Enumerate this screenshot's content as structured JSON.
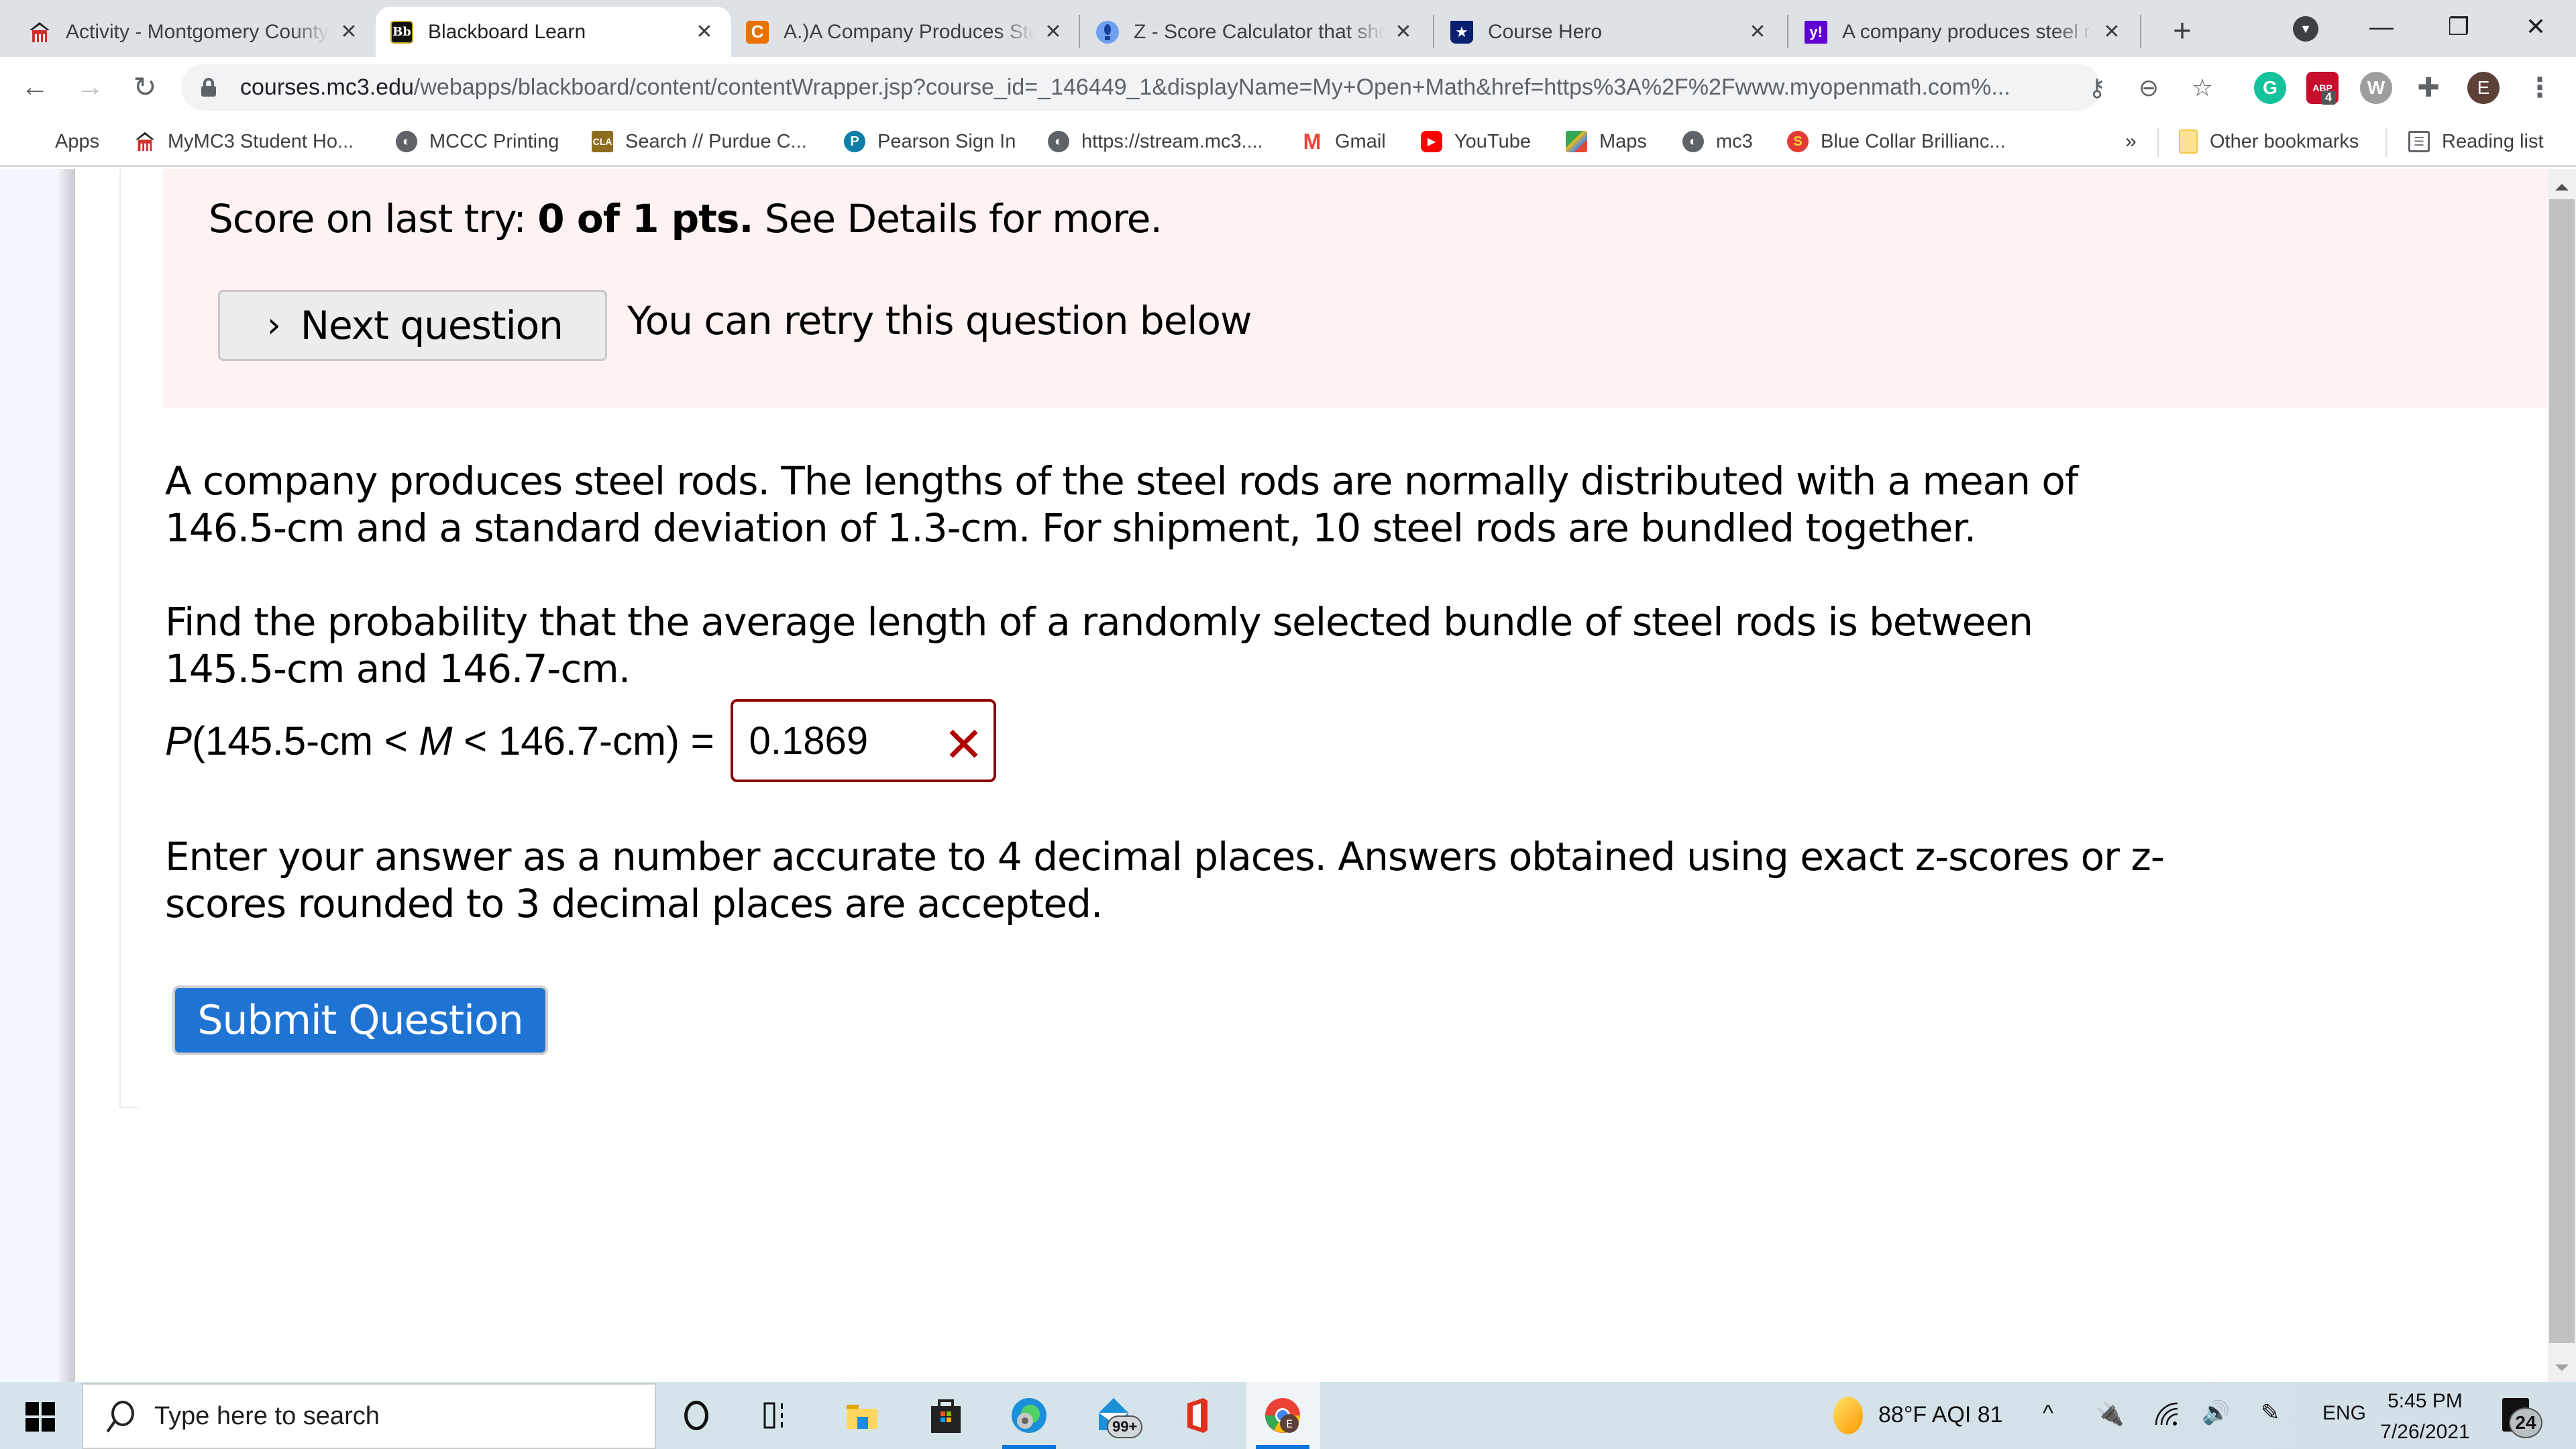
{
  "browser": {
    "tabs": [
      {
        "title": "Activity - Montgomery County Community College",
        "favicon": "mc3-icon",
        "favicon_color": "#d32f2f",
        "active": false
      },
      {
        "title": "Blackboard Learn",
        "favicon": "blackboard-icon",
        "favicon_color": "#111111",
        "favicon_text": "Bb",
        "active": true
      },
      {
        "title": "A.)A Company Produces Steel Rods",
        "favicon": "chegg-icon",
        "favicon_color": "#eb7100",
        "favicon_text": "C",
        "active": false
      },
      {
        "title": "Z - Score Calculator that shows work",
        "favicon": "calculator-icon",
        "favicon_color": "#6ea0f0",
        "active": false
      },
      {
        "title": "Course Hero",
        "favicon": "coursehero-icon",
        "favicon_color": "#0a1f6e",
        "favicon_text": "★",
        "active": false
      },
      {
        "title": "A company produces steel rods",
        "favicon": "yahoo-icon",
        "favicon_color": "#6001d2",
        "favicon_text": "y!",
        "active": false
      }
    ],
    "new_tab_label": "+",
    "tab_close_glyph": "✕",
    "window_controls": {
      "minimize": "—",
      "restore": "❐",
      "close": "✕"
    },
    "address": {
      "host": "courses.mc3.edu",
      "path": "/webapps/blackboard/content/contentWrapper.jsp?course_id=_146449_1&displayName=My+Open+Math&href=https%3A%2F%2Fwww.myopenmath.com%..."
    },
    "nav": {
      "back": "←",
      "forward": "→",
      "reload": "↻"
    },
    "omnibox_icons": {
      "key": "⚷",
      "zoom": "⊖",
      "star": "☆"
    },
    "extensions": [
      {
        "name": "grammarly",
        "label": "G",
        "color": "#15c39a"
      },
      {
        "name": "adblock",
        "label": "ABP",
        "color": "#c70d2c",
        "badge": "4"
      },
      {
        "name": "w-extension",
        "label": "W",
        "color": "#9e9e9e"
      },
      {
        "name": "extensions-puzzle",
        "label": "✚",
        "color": "#5f6368"
      },
      {
        "name": "profile",
        "label": "E",
        "color": "#5d4037"
      }
    ],
    "menu_glyph": "⋮",
    "bookmarks": [
      {
        "label": "Apps",
        "icon": "apps-grid-icon",
        "color": "#4285f4"
      },
      {
        "label": "MyMC3 Student Ho...",
        "icon": "mc3-icon",
        "color": "#d32f2f"
      },
      {
        "label": "MCCC Printing",
        "icon": "globe-icon",
        "color": "#5f6368"
      },
      {
        "label": "Search // Purdue C...",
        "icon": "purdue-icon",
        "color": "#8e6c1f"
      },
      {
        "label": "Pearson Sign In",
        "icon": "pearson-icon",
        "color": "#0d7ea8"
      },
      {
        "label": "https://stream.mc3....",
        "icon": "globe-icon",
        "color": "#5f6368"
      },
      {
        "label": "Gmail",
        "icon": "gmail-icon",
        "color": "#ea4335"
      },
      {
        "label": "YouTube",
        "icon": "youtube-icon",
        "color": "#ff0000"
      },
      {
        "label": "Maps",
        "icon": "maps-icon",
        "color": "#34a853"
      },
      {
        "label": "mc3",
        "icon": "globe-icon",
        "color": "#5f6368"
      },
      {
        "label": "Blue Collar Brillianc...",
        "icon": "s-icon",
        "color": "#e53935"
      }
    ],
    "bookmarks_overflow": "»",
    "other_bookmarks": "Other bookmarks",
    "reading_list": "Reading list"
  },
  "page": {
    "score": {
      "prefix": "Score on last try: ",
      "value": "0 of 1 pts.",
      "suffix": " See Details for more."
    },
    "next_question_label": "Next question",
    "next_question_glyph": "›",
    "retry_text": "You can retry this question below",
    "question_text_1": "A company produces steel rods. The lengths of the steel rods are normally distributed with a mean of 146.5-cm and a standard deviation of 1.3-cm. For shipment, 10 steel rods are bundled together.",
    "question_text_2": "Find the probability that the average length of a randomly selected bundle of steel rods is between 145.5-cm and 146.7-cm.",
    "prob_label_P": "P",
    "prob_label_mid1": "(145.5-cm < ",
    "prob_label_M": "M",
    "prob_label_mid2": " < 146.7-cm) =",
    "answer_value": "0.1869",
    "answer_status": "incorrect",
    "answer_status_glyph": "✕",
    "instructions": "Enter your answer as a number accurate to 4 decimal places. Answers obtained using exact z-scores or z-scores rounded to 3 decimal places are accepted.",
    "submit_label": "Submit Question",
    "colors": {
      "banner_bg": "#fff2f2",
      "error_border": "#8b0000",
      "submit_bg": "#1f74d3"
    }
  },
  "taskbar": {
    "search_placeholder": "Type here to search",
    "pinned": [
      "cortana",
      "task-view",
      "file-explorer",
      "microsoft-store",
      "edge",
      "mail",
      "office",
      "chrome"
    ],
    "mail_badge": "99+",
    "weather": "88°F  AQI 81",
    "tray_chevron": "^",
    "language": "ENG",
    "time": "5:45 PM",
    "date": "7/26/2021",
    "notifications_count": "24"
  }
}
